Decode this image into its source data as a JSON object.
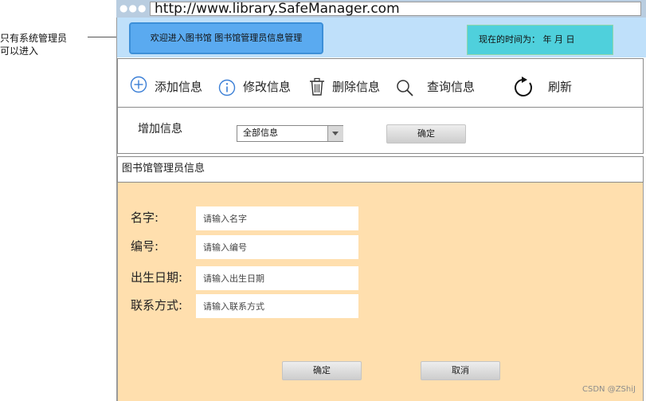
{
  "annotation": {
    "line1": "只有系统管理员",
    "line2": "可以进入"
  },
  "browser": {
    "dots": "●●●",
    "url": "http://www.library.SafeManager.com"
  },
  "header": {
    "welcome": "欢迎进入图书馆  图书馆管理员信息管理",
    "time_label": "现在的时间为：  年  月  日"
  },
  "toolbar": {
    "add": "添加信息",
    "edit": "修改信息",
    "delete": "删除信息",
    "search": "查询信息",
    "refresh": "刷新"
  },
  "filter": {
    "label": "增加信息",
    "select_value": "全部信息",
    "confirm": "确定"
  },
  "section": {
    "title": "图书馆管理员信息"
  },
  "form": {
    "name_label": "名字:",
    "name_placeholder": "请输入名字",
    "id_label": "编号:",
    "id_placeholder": "请输入编号",
    "birth_label": "出生日期:",
    "birth_placeholder": "请输入出生日期",
    "contact_label": "联系方式:",
    "contact_placeholder": "请输入联系方式",
    "confirm": "确定",
    "cancel": "取消"
  },
  "watermark": "CSDN @ZShiJ",
  "colors": {
    "header_bg": "#bfe0fa",
    "welcome_bg": "#5aaaf0",
    "time_bg": "#4fd0dc",
    "panel_bg": "#ffdfae",
    "icon_blue": "#3b7fd6"
  }
}
